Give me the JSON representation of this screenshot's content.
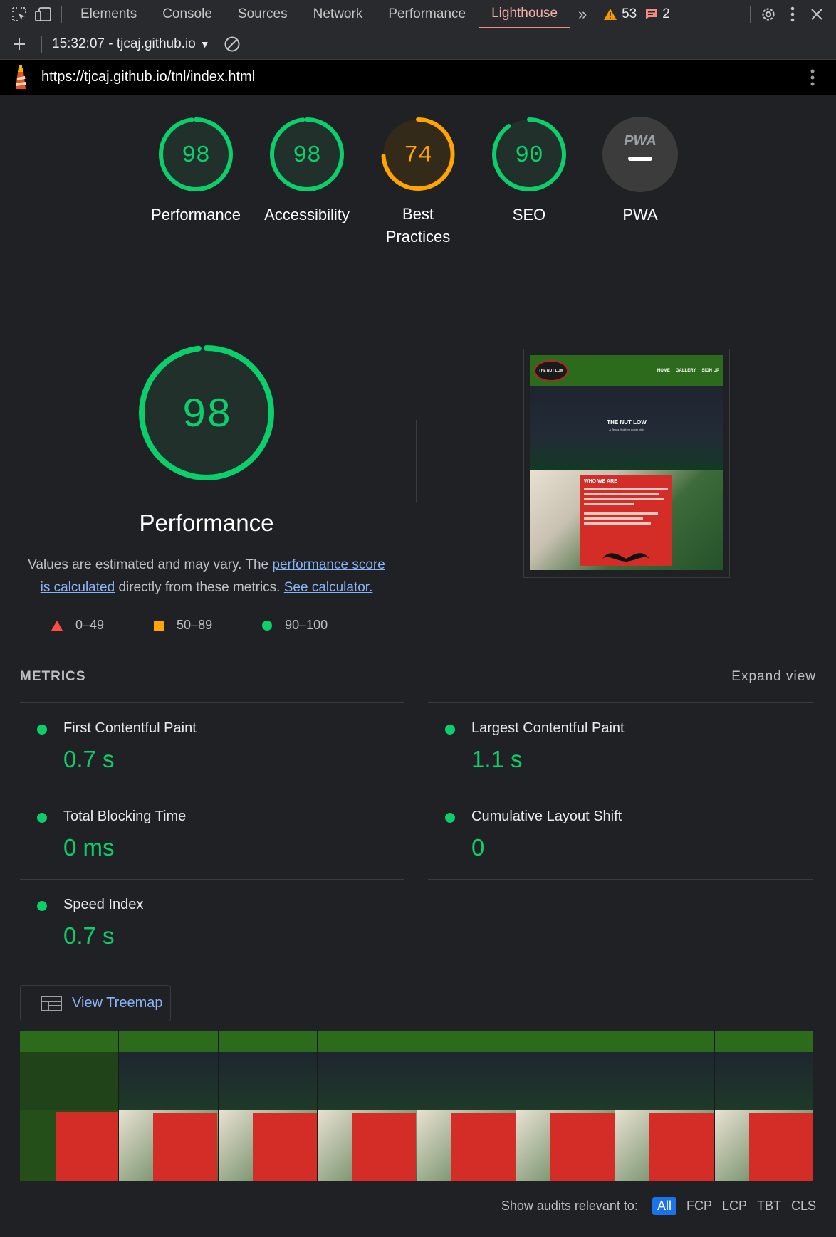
{
  "devtools": {
    "tabs": [
      "Elements",
      "Console",
      "Sources",
      "Network",
      "Performance",
      "Lighthouse"
    ],
    "active_tab": "Lighthouse",
    "warnings_count": "53",
    "messages_count": "2"
  },
  "report_bar": {
    "report_label": "15:32:07 - tjcaj.github.io"
  },
  "url_bar": {
    "url": "https://tjcaj.github.io/tnl/index.html"
  },
  "gauges": [
    {
      "label": "Performance",
      "score": "98",
      "color": "#0cce6b",
      "fraction": 0.98
    },
    {
      "label": "Accessibility",
      "score": "98",
      "color": "#0cce6b",
      "fraction": 0.98
    },
    {
      "label": "Best Practices",
      "score": "74",
      "color": "#ffa400",
      "fraction": 0.74
    },
    {
      "label": "SEO",
      "score": "90",
      "color": "#0cce6b",
      "fraction": 0.9
    },
    {
      "label": "PWA",
      "score": "PWA",
      "color": "#9aa0a6",
      "fraction": 0
    }
  ],
  "performance": {
    "score": "98",
    "title": "Performance",
    "desc_prefix": "Values are estimated and may vary. The ",
    "desc_link": "performance score is calculated",
    "desc_middle": " directly from these metrics. ",
    "desc_link2": "See calculator.",
    "legend": [
      "0–49",
      "50–89",
      "90–100"
    ]
  },
  "screenshot_preview": {
    "nav": [
      "HOME",
      "GALLERY",
      "SIGN UP"
    ],
    "hero_title": "THE NUT LOW",
    "hero_sub": "A Texas Hold'em poker club",
    "who_title": "WHO WE ARE",
    "logo_text": "THE NUT LOW"
  },
  "metrics": {
    "heading": "METRICS",
    "expand": "Expand view",
    "items": [
      {
        "name": "First Contentful Paint",
        "value": "0.7 s"
      },
      {
        "name": "Largest Contentful Paint",
        "value": "1.1 s"
      },
      {
        "name": "Total Blocking Time",
        "value": "0 ms"
      },
      {
        "name": "Cumulative Layout Shift",
        "value": "0"
      },
      {
        "name": "Speed Index",
        "value": "0.7 s"
      }
    ]
  },
  "treemap_button": "View Treemap",
  "filters": {
    "label": "Show audits relevant to:",
    "options": [
      "All",
      "FCP",
      "LCP",
      "TBT",
      "CLS"
    ],
    "active": "All"
  }
}
